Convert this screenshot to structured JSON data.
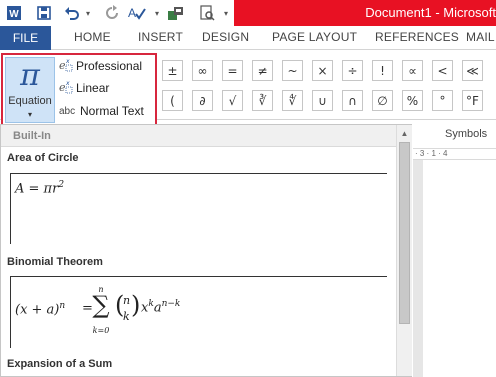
{
  "qat": {
    "icons": [
      "word-icon",
      "save-icon",
      "undo-icon",
      "undo-dropdown-icon",
      "redo-icon",
      "spelling-icon",
      "touch-mode-icon",
      "print-preview-icon",
      "customize-qat-icon"
    ]
  },
  "window": {
    "title": "Document1 - Microsoft",
    "title_bar_color": "#e81123"
  },
  "tabs": {
    "file": "FILE",
    "home": "HOME",
    "insert": "INSERT",
    "design": "DESIGN",
    "page_layout": "PAGE LAYOUT",
    "references": "REFERENCES",
    "mailings": "MAIL"
  },
  "ribbon": {
    "equation_label": "Equation",
    "equation_symbol": "π",
    "professional": "Professional",
    "linear": "Linear",
    "normal_text": "Normal Text",
    "normal_text_icon": "abc",
    "symbols_group_label": "Symbols",
    "symbols_row1": [
      "±",
      "∞",
      "=",
      "≠",
      "~",
      "×",
      "÷",
      "!",
      "∝",
      "<",
      "≪"
    ],
    "symbols_row2": [
      "(",
      "∂",
      "√",
      "∛",
      "∜",
      "∪",
      "∩",
      "∅",
      "%",
      "°",
      "°F"
    ],
    "accent_color": "#2b579a",
    "highlight_color": "#d7263d"
  },
  "gallery": {
    "header": "Built-In",
    "sections": {
      "area_title": "Area of Circle",
      "area_eq": "A = πr",
      "area_exp": "2",
      "binomial_title": "Binomial Theorem",
      "binomial_lhs": "(x + a)",
      "binomial_lhs_exp": "n",
      "binomial_eq": "=",
      "binomial_sigma": "∑",
      "binomial_top": "n",
      "binomial_bottom": "k=0",
      "binomial_n": "n",
      "binomial_k": "k",
      "binomial_rest_x": "x",
      "binomial_rest_kexp": "k",
      "binomial_rest_a": "a",
      "binomial_rest_aexp": "n−k",
      "expansion_title": "Expansion of a Sum"
    }
  },
  "ruler": {
    "marks": "· 3 · 1 · 4"
  }
}
